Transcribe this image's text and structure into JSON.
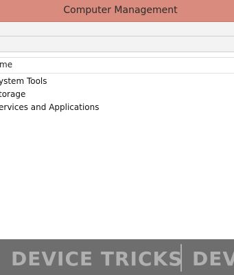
{
  "window": {
    "title": "Computer Management"
  },
  "tree": {
    "column_header": "me",
    "items": [
      {
        "label": "ystem Tools"
      },
      {
        "label": "torage"
      },
      {
        "label": "ervices and Applications"
      }
    ]
  },
  "watermark": {
    "brand": "DEVICE TRICKS",
    "brand_cut": "DEV"
  }
}
